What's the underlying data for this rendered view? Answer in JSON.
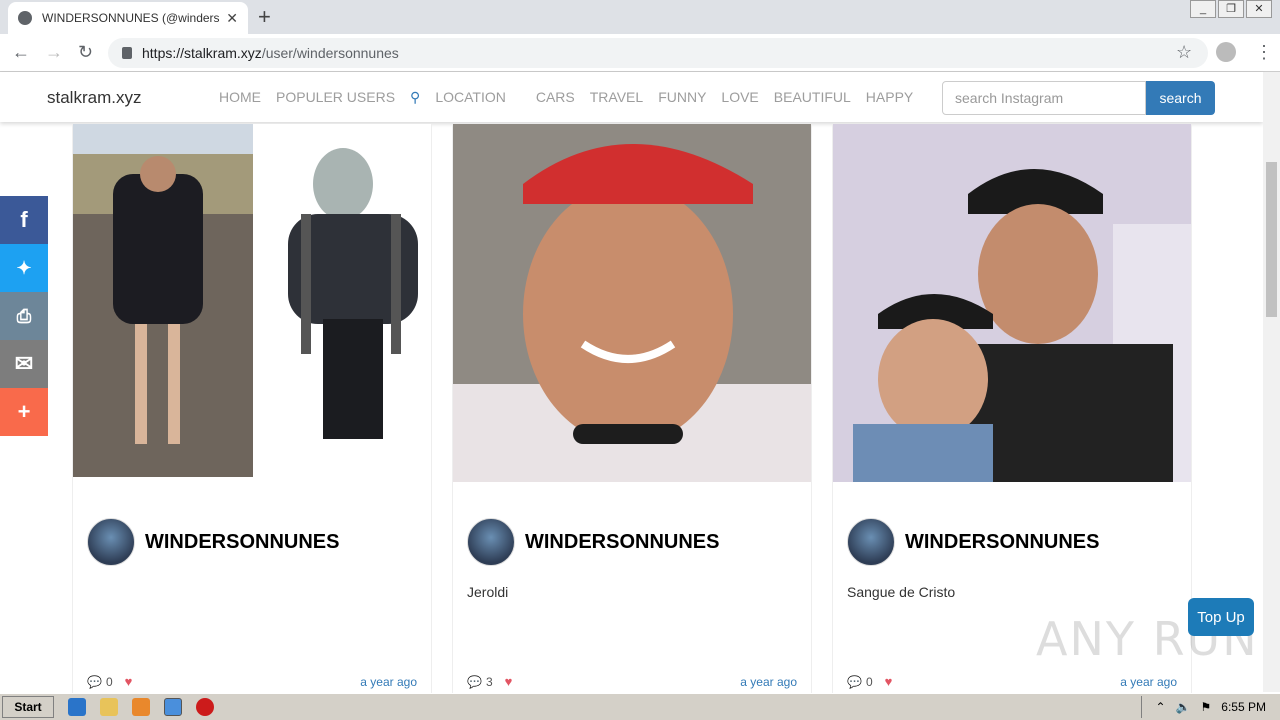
{
  "browser": {
    "tab_title": "WINDERSONNUNES (@windersonnunes)",
    "url_host": "https://stalkram.xyz",
    "url_path": "/user/windersonnunes"
  },
  "site": {
    "brand": "stalkram.xyz",
    "nav": [
      "HOME",
      "POPULER USERS",
      "LOCATION",
      "CARS",
      "TRAVEL",
      "FUNNY",
      "LOVE",
      "BEAUTIFUL",
      "HAPPY"
    ],
    "search_placeholder": "search Instagram",
    "search_button": "search"
  },
  "share": [
    {
      "icon": "facebook-icon",
      "glyph": "f",
      "color": "#3b5998"
    },
    {
      "icon": "twitter-icon",
      "glyph": "🐦",
      "color": "#1da1f2"
    },
    {
      "icon": "print-icon",
      "glyph": "⎙",
      "color": "#6d8699"
    },
    {
      "icon": "email-icon",
      "glyph": "✉",
      "color": "#7d7d7d"
    },
    {
      "icon": "plus-icon",
      "glyph": "+",
      "color": "#f96a4b"
    }
  ],
  "posts": [
    {
      "username": "WINDERSONNUNES",
      "caption": "",
      "comments": "0",
      "time": "a year ago"
    },
    {
      "username": "WINDERSONNUNES",
      "caption": "Jeroldi",
      "comments": "3",
      "time": "a year ago"
    },
    {
      "username": "WINDERSONNUNES",
      "caption": "Sangue de Cristo",
      "comments": "0",
      "time": "a year ago"
    }
  ],
  "top_up": "Top Up",
  "watermark": "ANY RUN",
  "taskbar": {
    "start": "Start",
    "clock": "6:55 PM"
  }
}
